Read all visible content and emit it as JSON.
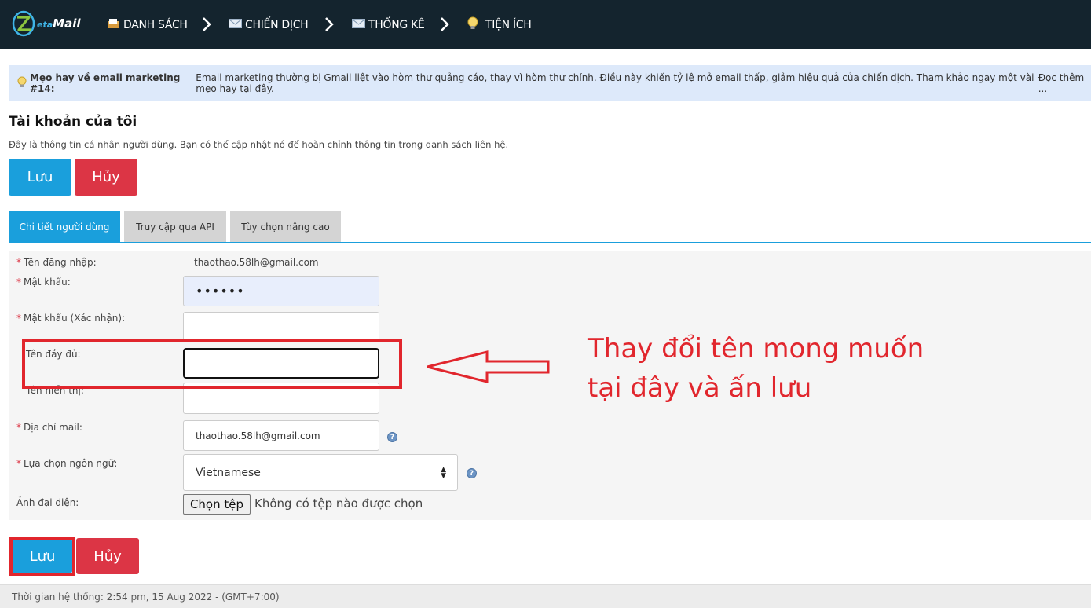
{
  "brand": {
    "logo_main": "eta",
    "logo_suffix": "Mail"
  },
  "nav": {
    "items": [
      {
        "label": "DANH SÁCH",
        "icon": "list-folder-icon"
      },
      {
        "label": "CHIẾN DỊCH",
        "icon": "envelope-icon"
      },
      {
        "label": "THỐNG KÊ",
        "icon": "envelope-icon"
      },
      {
        "label": "TIỆN ÍCH",
        "icon": "lightbulb-icon"
      }
    ]
  },
  "tip": {
    "title": "Mẹo hay về email marketing #14:",
    "text": "Email marketing thường bị Gmail liệt vào hòm thư quảng cáo, thay vì hòm thư chính. Điều này khiến tỷ lệ mở email thấp, giảm hiệu quả của chiến dịch. Tham khảo ngay một vài mẹo hay tại đây.",
    "link": "Đọc thêm ..."
  },
  "page": {
    "title": "Tài khoản của tôi",
    "description": "Đây là thông tin cá nhân người dùng. Bạn có thể cập nhật nó để hoàn chỉnh thông tin trong danh sách liên hệ."
  },
  "buttons": {
    "save": "Lưu",
    "cancel": "Hủy"
  },
  "tabs": [
    {
      "label": "Chi tiết người dùng",
      "active": true
    },
    {
      "label": "Truy cập qua API",
      "active": false
    },
    {
      "label": "Tùy chọn nâng cao",
      "active": false
    }
  ],
  "form": {
    "username_label": "Tên đăng nhập:",
    "username_value": "thaothao.58lh@gmail.com",
    "password_label": "Mật khẩu:",
    "password_value": "••••••",
    "password_confirm_label": "Mật khẩu (Xác nhận):",
    "password_confirm_value": "",
    "fullname_label": "Tên đầy đủ:",
    "fullname_value": "",
    "displayname_label": "Tên hiển thị:",
    "displayname_value": "",
    "email_label": "Địa chỉ mail:",
    "email_value": "thaothao.58lh@gmail.com",
    "language_label": "Lựa chọn ngôn ngữ:",
    "language_value": "Vietnamese",
    "avatar_label": "Ảnh đại diện:",
    "file_button": "Chọn tệp",
    "file_status": "Không có tệp nào được chọn",
    "required_mark": "*",
    "help_mark": "?"
  },
  "annotation": {
    "line1": "Thay đổi tên mong muốn",
    "line2": "tại đây và ấn lưu"
  },
  "footer": {
    "text": "Thời gian hệ thống: 2:54 pm, 15 Aug 2022 - (GMT+7:00)"
  },
  "colors": {
    "nav_bg": "#14242e",
    "primary": "#1a9fdc",
    "danger": "#dc3545",
    "annotation": "#e1262d",
    "tip_bg": "#dde9fa"
  }
}
